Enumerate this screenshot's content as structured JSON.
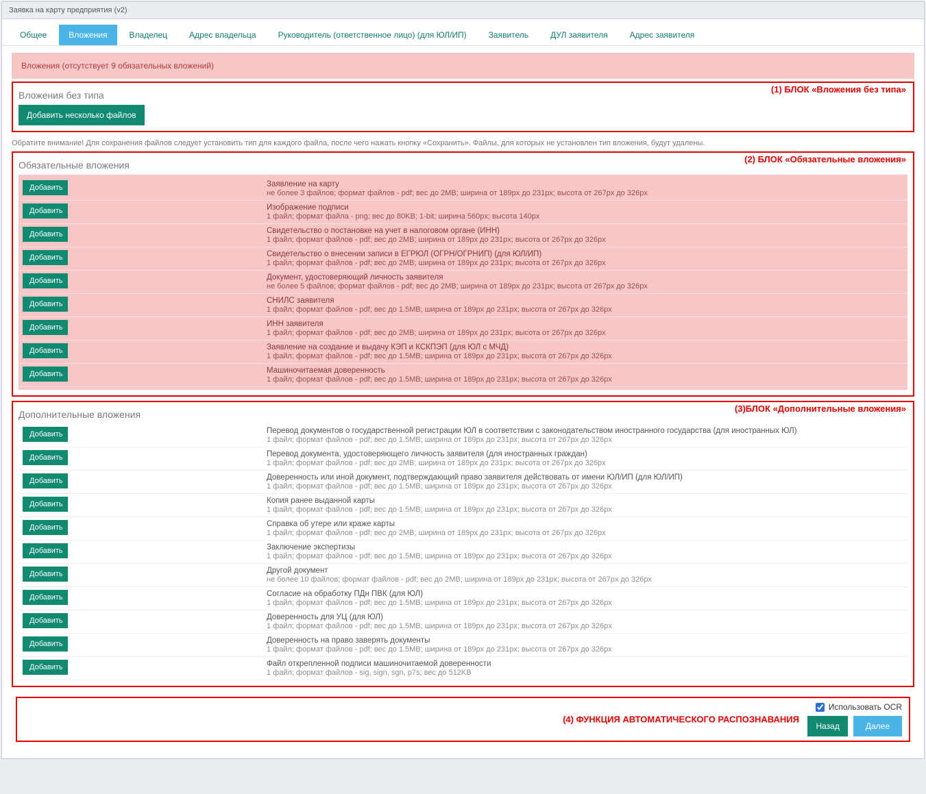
{
  "window": {
    "title": "Заявка на карту предприятия (v2)"
  },
  "tabs": [
    {
      "label": "Общее",
      "active": false
    },
    {
      "label": "Вложения",
      "active": true
    },
    {
      "label": "Владелец",
      "active": false
    },
    {
      "label": "Адрес владельца",
      "active": false
    },
    {
      "label": "Руководитель (ответственное лицо) (для ЮЛ/ИП)",
      "active": false
    },
    {
      "label": "Заявитель",
      "active": false
    },
    {
      "label": "ДУЛ заявителя",
      "active": false
    },
    {
      "label": "Адрес заявителя",
      "active": false
    }
  ],
  "alert": "Вложения (отсутствует 9 обязательных вложений)",
  "block1": {
    "header": "Вложения без типа",
    "badge": "(1) БЛОК «Вложения без типа»",
    "add_multi": "Добавить несколько файлов"
  },
  "note": "Обратите внимание! Для сохранения файлов следует установить тип для каждого файла, после чего нажать кнопку «Сохранить». Файлы, для которых не установлен тип вложения, будут удалены.",
  "block2": {
    "header": "Обязательные вложения",
    "badge": "(2) БЛОК «Обязательные вложения»",
    "add": "Добавить",
    "items": [
      {
        "title": "Заявление на карту",
        "desc": "не более 3 файлов; формат файлов - pdf; вес до 2MB; ширина от 189px до 231px; высота от 267px до 326px"
      },
      {
        "title": "Изображение подписи",
        "desc": "1 файл; формат файла - png; вес до 80KB; 1-bit; ширина 560px; высота 140px"
      },
      {
        "title": "Свидетельство о постановке на учет в налоговом органе (ИНН)",
        "desc": "1 файл; формат файлов - pdf; вес до 2MB; ширина от 189px до 231px; высота от 267px до 326px"
      },
      {
        "title": "Свидетельство о внесении записи в ЕГРЮЛ (ОГРН/ОГРНИП) (для ЮЛ/ИП)",
        "desc": "1 файл; формат файлов - pdf; вес до 2MB; ширина от 189px до 231px; высота от 267px до 326px"
      },
      {
        "title": "Документ, удостоверяющий личность заявителя",
        "desc": "не более 5 файлов; формат файлов - pdf; вес до 2MB; ширина от 189px до 231px; высота от 267px до 326px"
      },
      {
        "title": "СНИЛС заявителя",
        "desc": "1 файл; формат файлов - pdf; вес до 1.5MB; ширина от 189px до 231px; высота от 267px до 326px"
      },
      {
        "title": "ИНН заявителя",
        "desc": "1 файл; формат файлов - pdf; вес до 2MB; ширина от 189px до 231px; высота от 267px до 326px"
      },
      {
        "title": "Заявление на создание и выдачу КЭП и КСКПЭП (для ЮЛ с МЧД)",
        "desc": "1 файл; формат файлов - pdf; вес до 1.5MB; ширина от 189px до 231px; высота от 267px до 326px"
      },
      {
        "title": "Машиночитаемая доверенность",
        "desc": "1 файл; формат файлов - pdf; вес до 1.5MB; ширина от 189px до 231px; высота от 267px до 326px"
      }
    ]
  },
  "block3": {
    "header": "Дополнительные вложения",
    "badge": "(3)БЛОК «Дополнительные вложения»",
    "add": "Добавить",
    "items": [
      {
        "title": "Перевод документов о государственной регистрации ЮЛ в соответствии с законодательством иностранного государства (для иностранных ЮЛ)",
        "desc": "1 файл; формат файлов - pdf; вес до 1.5MB; ширина от 189px до 231px; высота от 267px до 326px"
      },
      {
        "title": "Перевод документа, удостоверяющего личность заявителя (для иностранных граждан)",
        "desc": "1 файл; формат файлов - pdf; вес до 2MB; ширина от 189px до 231px; высота от 267px до 326px"
      },
      {
        "title": "Доверенность или иной документ, подтверждающий право заявителя действовать от имени ЮЛ/ИП (для ЮЛ/ИП)",
        "desc": "1 файл; формат файлов - pdf; вес до 1.5MB; ширина от 189px до 231px; высота от 267px до 326px"
      },
      {
        "title": "Копия ранее выданной карты",
        "desc": "1 файл; формат файлов - pdf; вес до 1.5MB; ширина от 189px до 231px; высота от 267px до 326px"
      },
      {
        "title": "Справка об утере или краже карты",
        "desc": "1 файл; формат файлов - pdf; вес до 2MB; ширина от 189px до 231px; высота от 267px до 326px"
      },
      {
        "title": "Заключение экспертизы",
        "desc": "1 файл; формат файлов - pdf; вес до 1.5MB; ширина от 189px до 231px; высота от 267px до 326px"
      },
      {
        "title": "Другой документ",
        "desc": "не более 10 файлов; формат файлов - pdf; вес до 2MB; ширина от 189px до 231px; высота от 267px до 326px"
      },
      {
        "title": "Согласие на обработку ПДн ПВК (для ЮЛ)",
        "desc": "1 файл; формат файлов - pdf; вес до 1.5MB; ширина от 189px до 231px; высота от 267px до 326px"
      },
      {
        "title": "Доверенность для УЦ (для ЮЛ)",
        "desc": "1 файл; формат файлов - pdf; вес до 1.5MB; ширина от 189px до 231px; высота от 267px до 326px"
      },
      {
        "title": "Доверенность на право заверять документы",
        "desc": "1 файл; формат файлов - pdf; вес до 1.5MB; ширина от 189px до 231px; высота от 267px до 326px"
      },
      {
        "title": "Файл открепленной подписи машиночитаемой доверенности",
        "desc": "1 файл; формат файлов - sig, sign, sgn, p7s; вес до 512KB"
      }
    ]
  },
  "footer": {
    "badge": "(4) ФУНКЦИЯ АВТОМАТИЧЕСКОГО РАСПОЗНАВАНИЯ",
    "ocr_label": "Использовать OCR",
    "back": "Назад",
    "next": "Далее"
  }
}
